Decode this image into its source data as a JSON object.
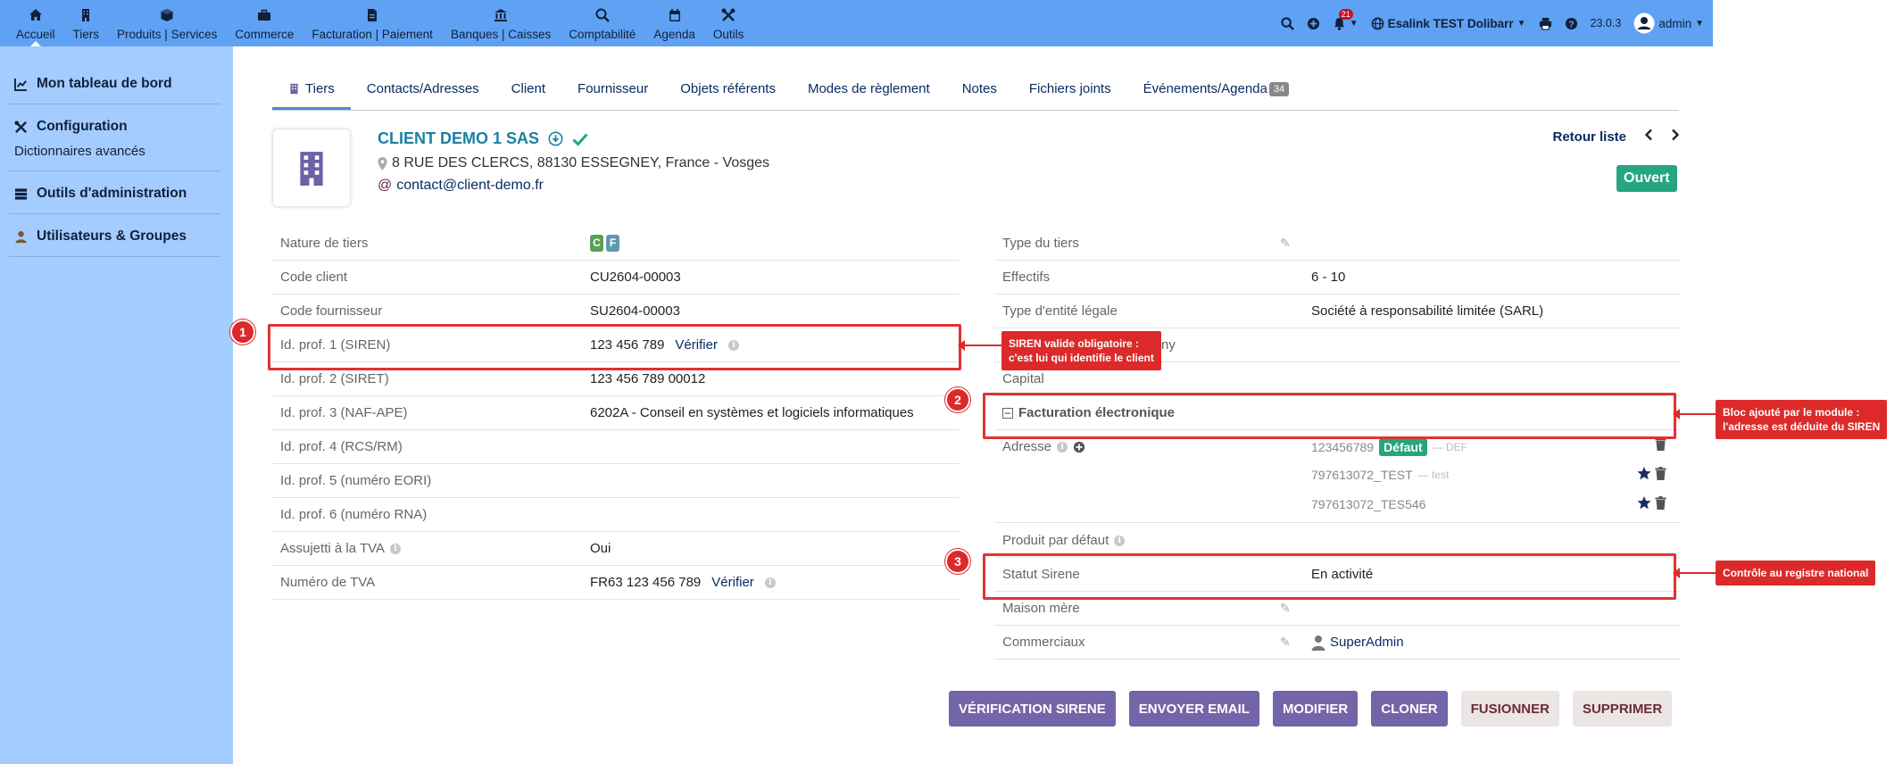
{
  "topmenu": [
    {
      "label": "Accueil",
      "icon": "home-icon",
      "active": true
    },
    {
      "label": "Tiers",
      "icon": "building-icon"
    },
    {
      "label": "Produits | Services",
      "icon": "cube-icon"
    },
    {
      "label": "Commerce",
      "icon": "briefcase-icon"
    },
    {
      "label": "Facturation | Paiement",
      "icon": "file-invoice-icon"
    },
    {
      "label": "Banques | Caisses",
      "icon": "bank-icon"
    },
    {
      "label": "Comptabilité",
      "icon": "search-dollar-icon"
    },
    {
      "label": "Agenda",
      "icon": "calendar-icon"
    },
    {
      "label": "Outils",
      "icon": "tools-icon"
    }
  ],
  "topright": {
    "notif_count": "21",
    "company": "Esalink TEST Dolibarr",
    "version": "23.0.3",
    "user": "admin"
  },
  "sidebar": {
    "dashboard": "Mon tableau de bord",
    "configuration": "Configuration",
    "dictionaries": "Dictionnaires avancés",
    "admin_tools": "Outils d'administration",
    "users_groups": "Utilisateurs & Groupes"
  },
  "tabs": [
    {
      "label": "Tiers",
      "active": true
    },
    {
      "label": "Contacts/Adresses"
    },
    {
      "label": "Client"
    },
    {
      "label": "Fournisseur"
    },
    {
      "label": "Objets référents"
    },
    {
      "label": "Modes de règlement"
    },
    {
      "label": "Notes"
    },
    {
      "label": "Fichiers joints"
    },
    {
      "label": "Événements/Agenda",
      "badge": "34"
    }
  ],
  "header": {
    "name": "CLIENT DEMO 1 SAS",
    "address": "8 RUE DES CLERCS, 88130 ESSEGNEY, France - Vosges",
    "email": "contact@client-demo.fr",
    "back_list": "Retour liste",
    "status": "Ouvert"
  },
  "left_fields": {
    "nature_label": "Nature de tiers",
    "nature_c": "C",
    "nature_f": "F",
    "code_client_label": "Code client",
    "code_client": "CU2604-00003",
    "code_fournisseur_label": "Code fournisseur",
    "code_fournisseur": "SU2604-00003",
    "prof1_label": "Id. prof. 1 (SIREN)",
    "prof1": "123 456 789",
    "verify": "Vérifier",
    "prof2_label": "Id. prof. 2 (SIRET)",
    "prof2": "123 456 789 00012",
    "prof3_label": "Id. prof. 3 (NAF-APE)",
    "prof3": "6202A - Conseil en systèmes et logiciels informatiques",
    "prof4_label": "Id. prof. 4 (RCS/RM)",
    "prof5_label": "Id. prof. 5 (numéro EORI)",
    "prof6_label": "Id. prof. 6 (numéro RNA)",
    "vat_subject_label": "Assujetti à la TVA",
    "vat_subject": "Oui",
    "vat_number_label": "Numéro de TVA",
    "vat_number": "FR63 123 456 789"
  },
  "right_fields": {
    "type_label": "Type du tiers",
    "effectifs_label": "Effectifs",
    "effectifs": "6 - 10",
    "legal_label": "Type d'entité légale",
    "legal": "Société à responsabilité limitée (SARL)",
    "company_partial": "ny",
    "capital_label": "Capital",
    "einvoice_label": "Facturation électronique",
    "address_label": "Adresse",
    "addr1": "123456789",
    "addr1_badge": "Défaut",
    "addr1_sub": "— DEF",
    "addr2": "797613072_TEST",
    "addr2_sub": "— test",
    "addr3": "797613072_TES546",
    "default_product_label": "Produit par défaut",
    "sirene_status_label": "Statut Sirene",
    "sirene_status": "En activité",
    "parent_label": "Maison mère",
    "sales_label": "Commerciaux",
    "sales": "SuperAdmin"
  },
  "annotations": {
    "n1": "1",
    "n2": "2",
    "n3": "3",
    "c1_line1": "SIREN valide obligatoire :",
    "c1_line2": "c'est lui qui identifie le client",
    "c2_line1": "Bloc ajouté par le module :",
    "c2_line2": "l'adresse est déduite du SIREN",
    "c3": "Contrôle au registre national"
  },
  "buttons": {
    "verify_sirene": "Vérification SIRENE",
    "send_email": "Envoyer email",
    "modify": "Modifier",
    "clone": "Cloner",
    "merge": "Fusionner",
    "delete": "Supprimer"
  },
  "colors": {
    "topbar": "#5fa2f4",
    "sidebar": "#a4ccff",
    "accent_green": "#25a580",
    "button_purple": "#7464a8",
    "annotation_red": "#dc2a2a"
  }
}
